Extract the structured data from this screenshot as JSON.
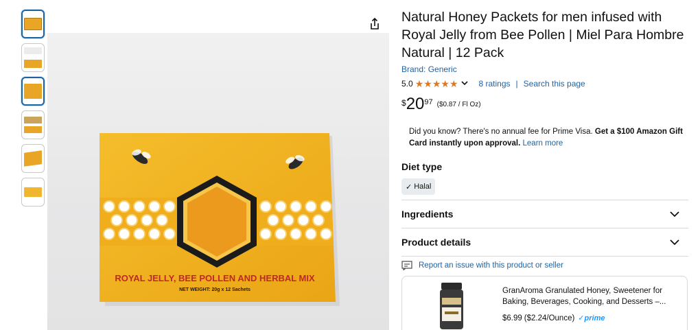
{
  "thumbnails": [
    {
      "name": "thumb-1",
      "selected": true,
      "color": "#e8a526"
    },
    {
      "name": "thumb-2",
      "selected": false,
      "color": "#d9d9d9"
    },
    {
      "name": "thumb-3",
      "selected": true,
      "color": "#e8a526"
    },
    {
      "name": "thumb-4",
      "selected": false,
      "color": "#caa45a"
    },
    {
      "name": "thumb-5",
      "selected": false,
      "color": "#e8a526"
    },
    {
      "name": "thumb-6",
      "selected": false,
      "color": "#f0b630"
    }
  ],
  "product_image": {
    "box_text": "ROYAL JELLY, BEE POLLEN AND HERBAL MIX",
    "box_subtext": "NET WEIGHT: 20g x 12 Sachets",
    "box_color": "#f2b31f",
    "text_color": "#c0262d"
  },
  "product": {
    "title": "Natural Honey Packets for men infused with Royal Jelly from Bee Pollen | Miel Para Hombre Natural | 12 Pack",
    "brand": "Brand: Generic",
    "rating": "5.0",
    "rating_count": "8 ratings",
    "search_page": "Search this page",
    "price_symbol": "$",
    "price_whole": "20",
    "price_fraction": "97",
    "unit_price": "($0.87 / Fl Oz)"
  },
  "promo": {
    "text": "Did you know? There's no annual fee for Prime Visa. ",
    "bold": "Get a $100 Amazon Gift Card instantly upon approval.",
    "link": "Learn more"
  },
  "diet": {
    "heading": "Diet type",
    "chip": "Halal"
  },
  "accordions": {
    "ingredients": "Ingredients",
    "details": "Product details"
  },
  "report": "Report an issue with this product or seller",
  "ad": {
    "title": "GranAroma Granulated Honey, Sweetener for Baking, Beverages, Cooking, and Desserts –...",
    "price": "$6.99",
    "per_unit": "($2.24/Ounce)",
    "prime": "✓prime"
  },
  "colors": {
    "link": "#2162a1",
    "star": "#de7921",
    "honey": "#f2b31f"
  }
}
